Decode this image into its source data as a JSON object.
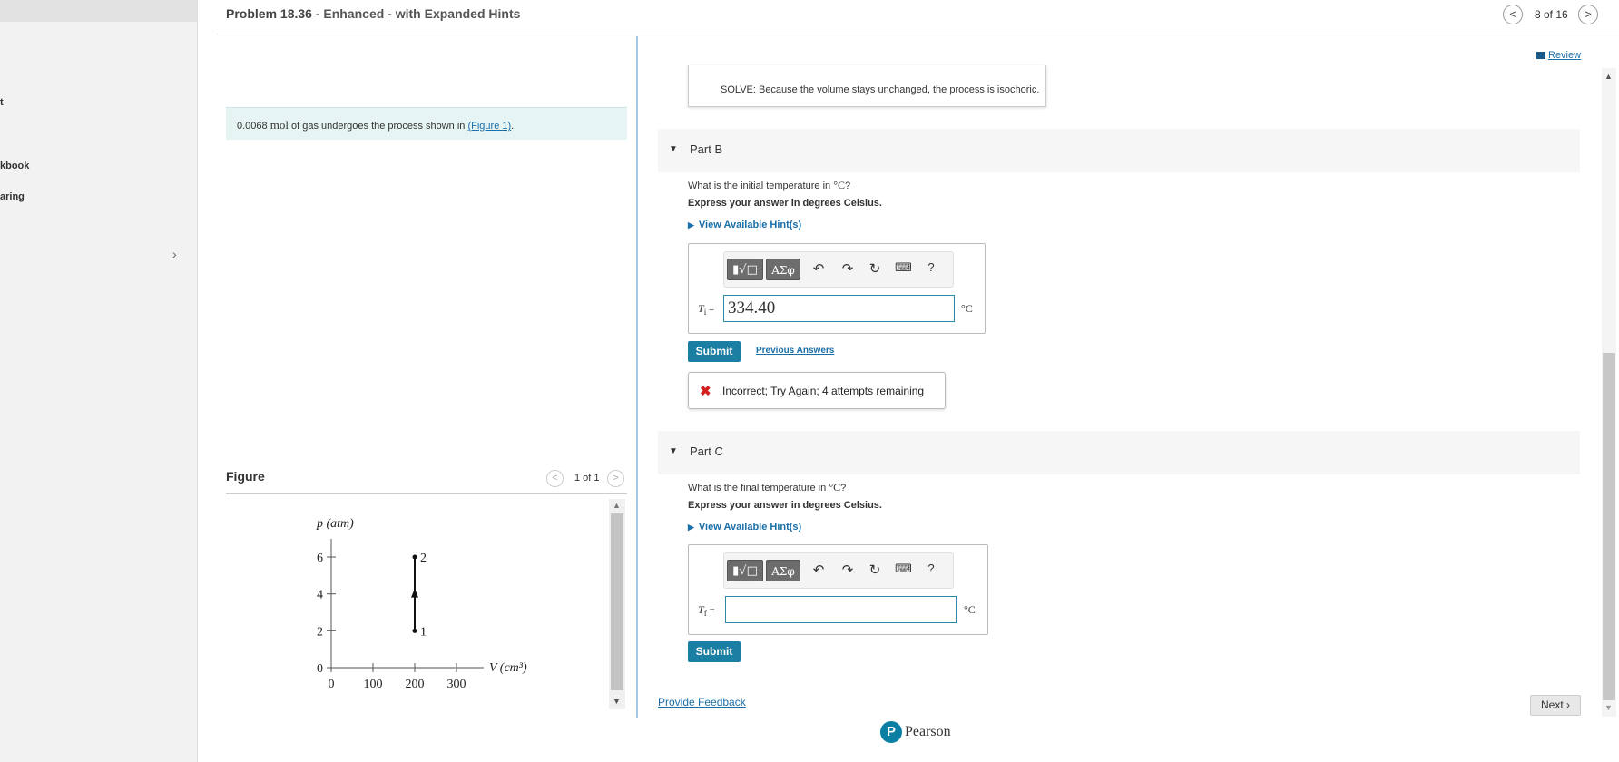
{
  "sidebar": {
    "items": [
      {
        "label": "t"
      },
      {
        "label": "kbook"
      },
      {
        "label": "aring"
      }
    ],
    "collapse_icon": "chevron-right"
  },
  "header": {
    "problem_title": "Problem 18.36",
    "problem_subtitle": "- Enhanced - with Expanded Hints",
    "pager": "8 of 16",
    "prev_icon": "<",
    "next_icon": ">"
  },
  "problem": {
    "intro_amount": "0.0068",
    "intro_unit": "mol",
    "intro_rest": "of gas undergoes the process shown in",
    "figure_link": "(Figure 1)",
    "intro_end": "."
  },
  "figure": {
    "label": "Figure",
    "count": "1 of 1",
    "prev_icon": "<",
    "next_icon": ">"
  },
  "chart_data": {
    "type": "line",
    "ylabel": "p (atm)",
    "xlabel": "V (cm³)",
    "x_ticks": [
      "0",
      "100",
      "200",
      "300"
    ],
    "y_ticks": [
      "0",
      "2",
      "4",
      "6"
    ],
    "xlim": [
      0,
      300
    ],
    "ylim": [
      0,
      6
    ],
    "points": [
      {
        "label": "1",
        "x": 200,
        "y": 2
      },
      {
        "label": "2",
        "x": 200,
        "y": 6
      }
    ],
    "arrow": "up"
  },
  "review": {
    "label": "Review"
  },
  "solve": {
    "text": "SOLVE: Because the volume stays unchanged, the process is isochoric."
  },
  "partB": {
    "label": "Part B",
    "question_pre": "What is the initial temperature in",
    "question_unit": "°C",
    "question_post": "?",
    "instruction": "Express your answer in degrees Celsius.",
    "hint": "View Available Hint(s)",
    "var": "T",
    "var_sub": "i",
    "var_eq": "=",
    "value": "334.40",
    "unit": "°C",
    "submit": "Submit",
    "previous_answers": "Previous Answers",
    "feedback": "Incorrect; Try Again; 4 attempts remaining"
  },
  "partC": {
    "label": "Part C",
    "question_pre": "What is the final temperature in",
    "question_unit": "°C",
    "question_post": "?",
    "instruction": "Express your answer in degrees Celsius.",
    "hint": "View Available Hint(s)",
    "var": "T",
    "var_sub": "f",
    "var_eq": "=",
    "value": "",
    "unit": "°C",
    "submit": "Submit"
  },
  "toolbar": {
    "template_btn": "▮√□",
    "greek_btn": "ΑΣφ",
    "help": "?"
  },
  "footer": {
    "provide_feedback": "Provide Feedback",
    "next": "Next",
    "pearson": "Pearson",
    "pearson_logo": "P"
  }
}
